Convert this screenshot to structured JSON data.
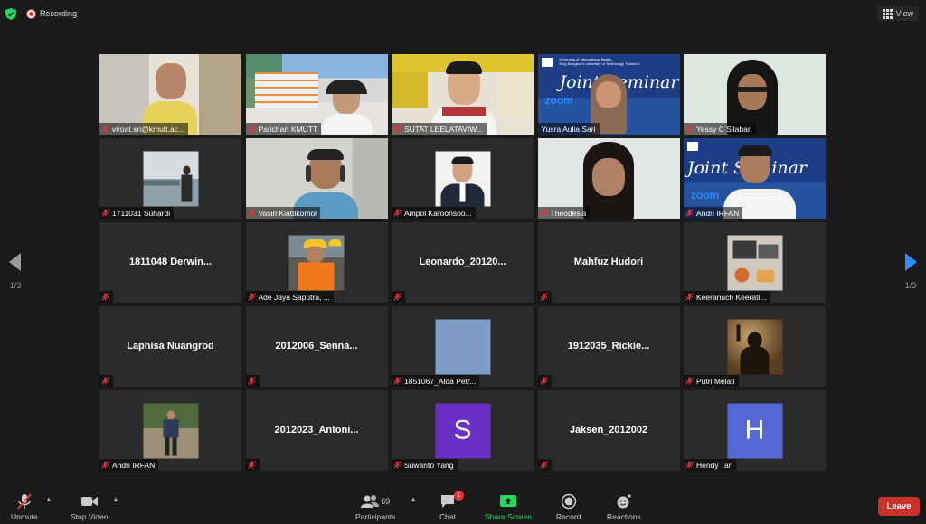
{
  "top": {
    "recording_label": "Recording",
    "view_label": "View"
  },
  "paging": {
    "left_count": "1/3",
    "right_count": "1/3"
  },
  "tiles": [
    {
      "name": "viroat.sri@kmutt.ac...",
      "kind": "video"
    },
    {
      "name": "Parichart KMUTT",
      "kind": "video"
    },
    {
      "name": "SUTAT LEELATAVIW...",
      "kind": "video"
    },
    {
      "name": "Yusra Aulia Sari",
      "kind": "video",
      "active": true,
      "screen_text": "University of International Batam\nKing Mongkut's University of Technology Thonburi",
      "seminar": "Joint Seminar",
      "zoom": "zoom"
    },
    {
      "name": "Yessy C Silaban",
      "kind": "video"
    },
    {
      "name": "1711031 Suhardi",
      "kind": "photo"
    },
    {
      "name": "Vasin Kiattikomol",
      "kind": "video"
    },
    {
      "name": "Ampol Karoonsoo...",
      "kind": "photo"
    },
    {
      "name": "Theodesia",
      "kind": "video"
    },
    {
      "name": "Andri IRFAN",
      "kind": "video"
    },
    {
      "name": "",
      "big": "1811048 Derwin...",
      "kind": "name"
    },
    {
      "name": "Ade Jaya Saputra, ...",
      "kind": "photo"
    },
    {
      "name": "",
      "big": "Leonardo_20120...",
      "kind": "name"
    },
    {
      "name": "",
      "big": "Mahfuz Hudori",
      "kind": "name"
    },
    {
      "name": "Keeranuch Keerati...",
      "kind": "photo"
    },
    {
      "name": "",
      "big": "Laphisa Nuangrod",
      "kind": "name"
    },
    {
      "name": "",
      "big": "2012006_Senna...",
      "kind": "name"
    },
    {
      "name": "1851067_Alda Petr...",
      "kind": "photo"
    },
    {
      "name": "",
      "big": "1912035_Rickie...",
      "kind": "name"
    },
    {
      "name": "Putri Melati",
      "kind": "photo"
    },
    {
      "name": "Andri IRFAN",
      "kind": "photo"
    },
    {
      "name": "",
      "big": "2012023_Antoni...",
      "kind": "name"
    },
    {
      "name": "Suwanto Yang",
      "kind": "letter",
      "letter": "S",
      "color": "#6a2fc4"
    },
    {
      "name": "",
      "big": "Jaksen_2012002",
      "kind": "name"
    },
    {
      "name": "Hendy Tan",
      "kind": "letter",
      "letter": "H",
      "color": "#5569d6"
    }
  ],
  "toolbar": {
    "unmute": "Unmute",
    "stop_video": "Stop Video",
    "participants": "Participants",
    "participants_count": "69",
    "chat": "Chat",
    "chat_badge": "1",
    "share_screen": "Share Screen",
    "record": "Record",
    "reactions": "Reactions",
    "leave": "Leave"
  },
  "colors": {
    "active_border": "#e8e35a",
    "share_green": "#23d959",
    "leave_red": "#c9312d",
    "mic_off_red": "#e0353c"
  }
}
